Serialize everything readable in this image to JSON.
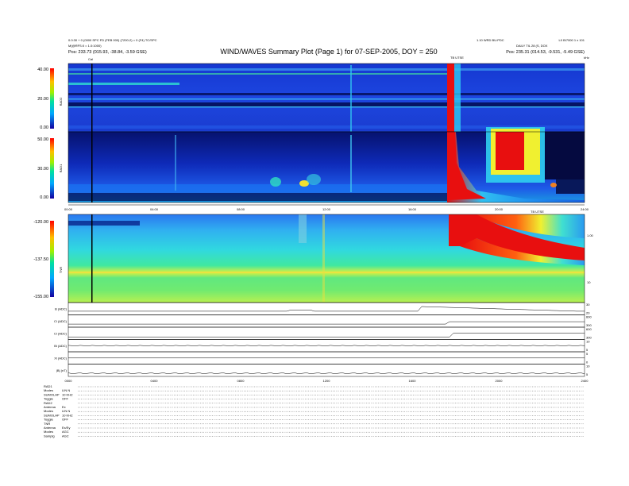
{
  "header": {
    "title": "WIND/WAVES Summary Plot (Page 1) for 07-SEP-2005, DOY = 250",
    "left_line1": "0.0:30 + 0 (0000 SPC FD (FEB 000) (7200-2) = 0 (F4) TC/SPC",
    "left_line2": "M(@RFS:0 = 1.0:1000)",
    "left_pos": "Pos: 233.73 (015.93, -38.84, -3.59 GSE)",
    "right_line1": "1.10 WRD BU:PDC",
    "right_line1b": "L0 B/7000 1 x 101",
    "right_line2": "DAILY TIL 28 (S, DOX",
    "right_pos": "Pos: 235.31 (014.53, -9.531, -5.49 GSE)",
    "cal_label": "Cal",
    "tnr_marker": "TB UTSE",
    "unit_right": "kHz"
  },
  "chart_data": [
    {
      "type": "heatmap",
      "name": "RAD2",
      "ylabel": "RAD2",
      "ylim": [
        0,
        40
      ],
      "yticks": [
        "40.00",
        "20.00",
        "0.00"
      ],
      "colorscale": "rainbow"
    },
    {
      "type": "heatmap",
      "name": "RAD1",
      "ylabel": "RAD1",
      "ylim": [
        0,
        50
      ],
      "yticks": [
        "50.00",
        "30.00",
        "0.00"
      ],
      "colorscale": "rainbow"
    },
    {
      "type": "heatmap",
      "name": "TNR",
      "ylabel": "TNR",
      "ylim": [
        -155,
        -120
      ],
      "yticks": [
        "-120.00",
        "-137.50",
        "-155.00"
      ],
      "right_ticks": [
        "1.00",
        "10"
      ],
      "colorscale": "rainbow"
    },
    {
      "type": "line",
      "name": "key-parameters",
      "xticks": [
        "00:00",
        "04:00",
        "08:00",
        "12:00",
        "16:00",
        "20:00",
        "24:00"
      ],
      "xticks_bottom": [
        "0000",
        "0400",
        "0800",
        "1200",
        "1600",
        "2000",
        "2400"
      ],
      "panels": [
        {
          "label": "B (ADC)",
          "right": "30 / 20"
        },
        {
          "label": "Ci (ADC)",
          "right": "600 / 300"
        },
        {
          "label": "Ci (ADC)",
          "right": "600 / 300"
        },
        {
          "label": "Bi (ADC)",
          "right": "10 / 5"
        },
        {
          "label": "Xi (ADC)",
          "right": "5 / 0"
        },
        {
          "label": "|B| (nT)",
          "right": "10 / 5"
        }
      ]
    }
  ],
  "footer": {
    "blocks": [
      {
        "rows": [
          [
            "RAD1",
            ""
          ],
          [
            "Modes",
            "LIN N"
          ],
          [
            "SUMOLAP",
            "10 KHZ"
          ],
          [
            "Toggle",
            "OFF"
          ]
        ]
      },
      {
        "rows": [
          [
            "RAD2",
            ""
          ],
          [
            "Antenna",
            "Ex"
          ],
          [
            "Modes",
            "LIN N"
          ],
          [
            "SUMOLAP",
            "10 KHZ"
          ],
          [
            "Toggle",
            "OFF"
          ]
        ]
      },
      {
        "rows": [
          [
            "TNR",
            ""
          ],
          [
            "Antenna",
            "Ex/Ey"
          ],
          [
            "Modes",
            "AGC"
          ],
          [
            "Samplg",
            "AGC"
          ]
        ]
      }
    ]
  },
  "colors": {
    "bg_blue": "#1230c8",
    "deep_blue": "#000a66",
    "cyan": "#21d2f0",
    "green": "#26e07a",
    "yellow": "#f0f030",
    "red": "#e80f0f"
  }
}
